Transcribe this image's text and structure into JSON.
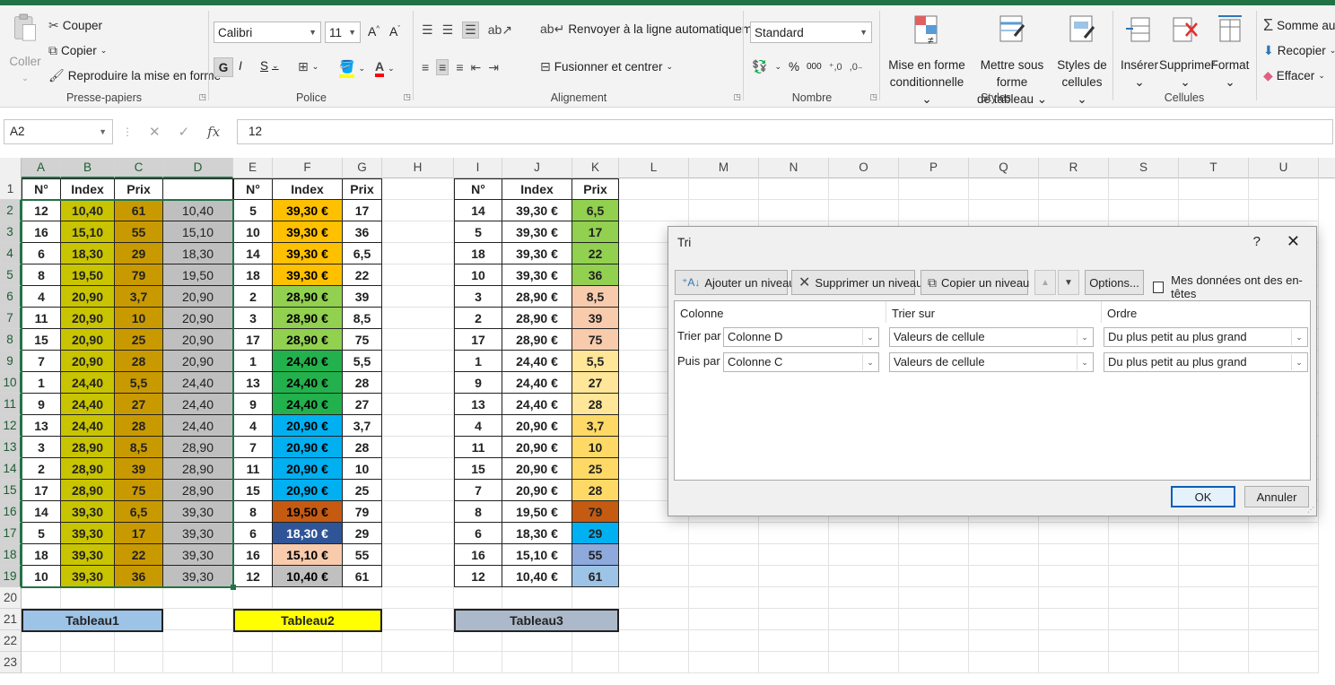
{
  "ribbon": {
    "clipboard": {
      "group": "Presse-papiers",
      "paste": "Coller",
      "cut": "Couper",
      "copy": "Copier",
      "format_painter": "Reproduire la mise en forme"
    },
    "font": {
      "group": "Police",
      "font_name": "Calibri",
      "font_size": "11",
      "bold": "G",
      "italic": "I",
      "underline": "S"
    },
    "alignment": {
      "group": "Alignement",
      "wrap": "Renvoyer à la ligne automatiquement",
      "merge": "Fusionner et centrer"
    },
    "number": {
      "group": "Nombre",
      "format": "Standard",
      "percent": "%",
      "thousands": "000"
    },
    "styles": {
      "group": "Styles",
      "conditional": [
        "Mise en forme",
        "conditionnelle"
      ],
      "as_table": [
        "Mettre sous forme",
        "de tableau"
      ],
      "cell_styles": [
        "Styles de",
        "cellules"
      ]
    },
    "cells": {
      "group": "Cellules",
      "insert": "Insérer",
      "delete": "Supprimer",
      "format": "Format"
    },
    "editing": {
      "autosum": "Somme aut",
      "fill": "Recopier",
      "clear": "Effacer"
    }
  },
  "formula_bar": {
    "name_box": "A2",
    "cancel": "✕",
    "enter": "✓",
    "fx": "fx",
    "value": "12"
  },
  "columns": [
    "A",
    "B",
    "C",
    "D",
    "E",
    "F",
    "G",
    "H",
    "I",
    "J",
    "K",
    "L",
    "M",
    "N",
    "O",
    "P",
    "Q",
    "R",
    "S",
    "T",
    "U"
  ],
  "rows": [
    "1",
    "2",
    "3",
    "4",
    "5",
    "6",
    "7",
    "8",
    "9",
    "10",
    "11",
    "12",
    "13",
    "14",
    "15",
    "16",
    "17",
    "18",
    "19",
    "20",
    "21",
    "22",
    "23"
  ],
  "table1": {
    "headers": [
      "N°",
      "Index",
      "Prix"
    ],
    "rows": [
      [
        "12",
        "10,40",
        "61",
        "10,40"
      ],
      [
        "16",
        "15,10",
        "55",
        "15,10"
      ],
      [
        "6",
        "18,30",
        "29",
        "18,30"
      ],
      [
        "8",
        "19,50",
        "79",
        "19,50"
      ],
      [
        "4",
        "20,90",
        "3,7",
        "20,90"
      ],
      [
        "11",
        "20,90",
        "10",
        "20,90"
      ],
      [
        "15",
        "20,90",
        "25",
        "20,90"
      ],
      [
        "7",
        "20,90",
        "28",
        "20,90"
      ],
      [
        "1",
        "24,40",
        "5,5",
        "24,40"
      ],
      [
        "9",
        "24,40",
        "27",
        "24,40"
      ],
      [
        "13",
        "24,40",
        "28",
        "24,40"
      ],
      [
        "3",
        "28,90",
        "8,5",
        "28,90"
      ],
      [
        "2",
        "28,90",
        "39",
        "28,90"
      ],
      [
        "17",
        "28,90",
        "75",
        "28,90"
      ],
      [
        "14",
        "39,30",
        "6,5",
        "39,30"
      ],
      [
        "5",
        "39,30",
        "17",
        "39,30"
      ],
      [
        "18",
        "39,30",
        "22",
        "39,30"
      ],
      [
        "10",
        "39,30",
        "36",
        "39,30"
      ]
    ],
    "label": "Tableau1"
  },
  "table2": {
    "headers": [
      "N°",
      "Index",
      "Prix"
    ],
    "rows": [
      [
        "5",
        "39,30 €",
        "17"
      ],
      [
        "10",
        "39,30 €",
        "36"
      ],
      [
        "14",
        "39,30 €",
        "6,5"
      ],
      [
        "18",
        "39,30 €",
        "22"
      ],
      [
        "2",
        "28,90 €",
        "39"
      ],
      [
        "3",
        "28,90 €",
        "8,5"
      ],
      [
        "17",
        "28,90 €",
        "75"
      ],
      [
        "1",
        "24,40 €",
        "5,5"
      ],
      [
        "13",
        "24,40 €",
        "28"
      ],
      [
        "9",
        "24,40 €",
        "27"
      ],
      [
        "4",
        "20,90 €",
        "3,7"
      ],
      [
        "7",
        "20,90 €",
        "28"
      ],
      [
        "11",
        "20,90 €",
        "10"
      ],
      [
        "15",
        "20,90 €",
        "25"
      ],
      [
        "8",
        "19,50 €",
        "79"
      ],
      [
        "6",
        "18,30 €",
        "29"
      ],
      [
        "16",
        "15,10 €",
        "55"
      ],
      [
        "12",
        "10,40 €",
        "61"
      ]
    ],
    "index_colors": [
      "#ffc000",
      "#ffc000",
      "#ffc000",
      "#ffc000",
      "#92d050",
      "#92d050",
      "#92d050",
      "#22b14c",
      "#22b14c",
      "#22b14c",
      "#00b0f0",
      "#00b0f0",
      "#00b0f0",
      "#00b0f0",
      "#c55a11",
      "#2f5597",
      "#f8cbad",
      "#c0c0c0"
    ],
    "label": "Tableau2"
  },
  "table3": {
    "headers": [
      "N°",
      "Index",
      "Prix"
    ],
    "rows": [
      [
        "14",
        "39,30 €",
        "6,5"
      ],
      [
        "5",
        "39,30 €",
        "17"
      ],
      [
        "18",
        "39,30 €",
        "22"
      ],
      [
        "10",
        "39,30 €",
        "36"
      ],
      [
        "3",
        "28,90 €",
        "8,5"
      ],
      [
        "2",
        "28,90 €",
        "39"
      ],
      [
        "17",
        "28,90 €",
        "75"
      ],
      [
        "1",
        "24,40 €",
        "5,5"
      ],
      [
        "9",
        "24,40 €",
        "27"
      ],
      [
        "13",
        "24,40 €",
        "28"
      ],
      [
        "4",
        "20,90 €",
        "3,7"
      ],
      [
        "11",
        "20,90 €",
        "10"
      ],
      [
        "15",
        "20,90 €",
        "25"
      ],
      [
        "7",
        "20,90 €",
        "28"
      ],
      [
        "8",
        "19,50 €",
        "79"
      ],
      [
        "6",
        "18,30 €",
        "29"
      ],
      [
        "16",
        "15,10 €",
        "55"
      ],
      [
        "12",
        "10,40 €",
        "61"
      ]
    ],
    "prix_colors": [
      "#92d050",
      "#92d050",
      "#92d050",
      "#92d050",
      "#f8cbad",
      "#f8cbad",
      "#f8cbad",
      "#ffe699",
      "#ffe699",
      "#ffe699",
      "#ffd966",
      "#ffd966",
      "#ffd966",
      "#ffd966",
      "#c55a11",
      "#00b0f0",
      "#8ea9db",
      "#9dc3e6"
    ],
    "label": "Tableau3"
  },
  "colors": {
    "excel_green": "#217346",
    "t1_index": "#c9c400",
    "t1_prix": "#c99a00",
    "t1_d": "#bfbfbf",
    "label1": "#9dc3e6",
    "label2": "#ffff00",
    "label3": "#acb9ca"
  },
  "dialog": {
    "title": "Tri",
    "help": "?",
    "close": "✕",
    "add_level": "Ajouter un niveau",
    "delete_level": "Supprimer un niveau",
    "copy_level": "Copier un niveau",
    "options": "Options...",
    "headers_checkbox": "Mes données ont des en-têtes",
    "col_header": "Colonne",
    "sort_on_header": "Trier sur",
    "order_header": "Ordre",
    "levels": [
      {
        "label": "Trier par",
        "column": "Colonne D",
        "sort_on": "Valeurs de cellule",
        "order": "Du plus petit au plus grand"
      },
      {
        "label": "Puis par",
        "column": "Colonne C",
        "sort_on": "Valeurs de cellule",
        "order": "Du plus petit au plus grand"
      }
    ],
    "ok": "OK",
    "cancel": "Annuler"
  }
}
